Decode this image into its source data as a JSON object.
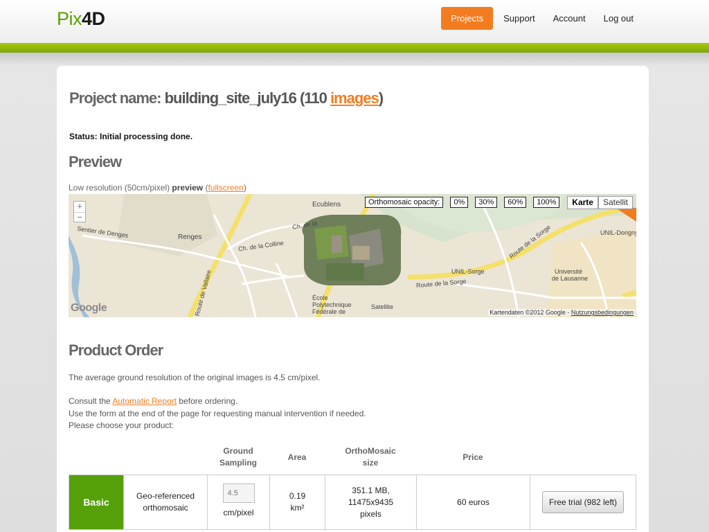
{
  "brand": {
    "part1": "Pix",
    "part2": "4D"
  },
  "nav": [
    {
      "label": "Projects",
      "active": true
    },
    {
      "label": "Support",
      "active": false
    },
    {
      "label": "Account",
      "active": false
    },
    {
      "label": "Log out",
      "active": false
    }
  ],
  "project": {
    "title_prefix": "Project name: ",
    "name": "building_site_july16",
    "count_open": " (110 ",
    "images_link": "images",
    "count_close": ")",
    "status": "Status: Initial processing done."
  },
  "preview": {
    "heading": "Preview",
    "resolution_text": "Low resolution (50cm/pixel) ",
    "preview_word": "preview",
    "paren_open": " (",
    "fullscreen_link": "fullscreen",
    "paren_close": ")"
  },
  "map": {
    "zoom_in": "+",
    "zoom_out": "−",
    "opacity_label": "Orthomosaic opacity:",
    "opacity_options": [
      "0%",
      "30%",
      "60%",
      "100%"
    ],
    "map_type_karte": "Karte",
    "map_type_satellit": "Satellit",
    "labels": {
      "ecublens": "Ecublens",
      "renges": "Renges",
      "sentier_denges": "Sentier de Denges",
      "ch_colline": "Ch. de la Colline",
      "ch_de_la": "Ch. de la",
      "unil_sorge": "UNIL-Sorge",
      "route_sorge": "Route de la Sorge",
      "universite": "Université",
      "de_lausanne": "de Lausanne",
      "ecole": "École",
      "polytechnique": "Polytechnique",
      "federale": "Fédérale de",
      "satellite": "Satellite",
      "unil_dorigny": "UNIL-Dorigny",
      "route_vallaire": "Route de Vallaire",
      "route_sorge_2": "Route de la Sorge"
    },
    "google": "Google",
    "copyright": "Kartendaten ©2012 Google - ",
    "terms_link": "Nutzungsbedingungen"
  },
  "order": {
    "heading": "Product Order",
    "avg_resolution": "The average ground resolution of the original images is 4.5 cm/pixel.",
    "consult_prefix": "Consult the ",
    "report_link": "Automatic Report",
    "consult_suffix": " before ordering.",
    "form_note": "Use the form at the end of the page for requesting manual intervention if needed.",
    "choose": "Please choose your product:",
    "columns": {
      "ground1": "Ground",
      "ground2": "Sampling",
      "area": "Area",
      "ortho1": "OrthoMosaic",
      "ortho2": "size",
      "price": "Price"
    },
    "row": {
      "product": "Basic",
      "desc1": "Geo-referenced",
      "desc2": "orthomosaic",
      "gsd_value": "4.5",
      "gsd_unit": "cm/pixel",
      "area1": "0.19",
      "area2": "km²",
      "size1": "351.1 MB,",
      "size2": "11475x9435",
      "size3": "pixels",
      "price": "60 euros",
      "button": "Free trial (982 left)"
    }
  },
  "colors": {
    "accent": "#f47c20",
    "brand_green": "#56a00a",
    "stripe": "#94b80c"
  }
}
